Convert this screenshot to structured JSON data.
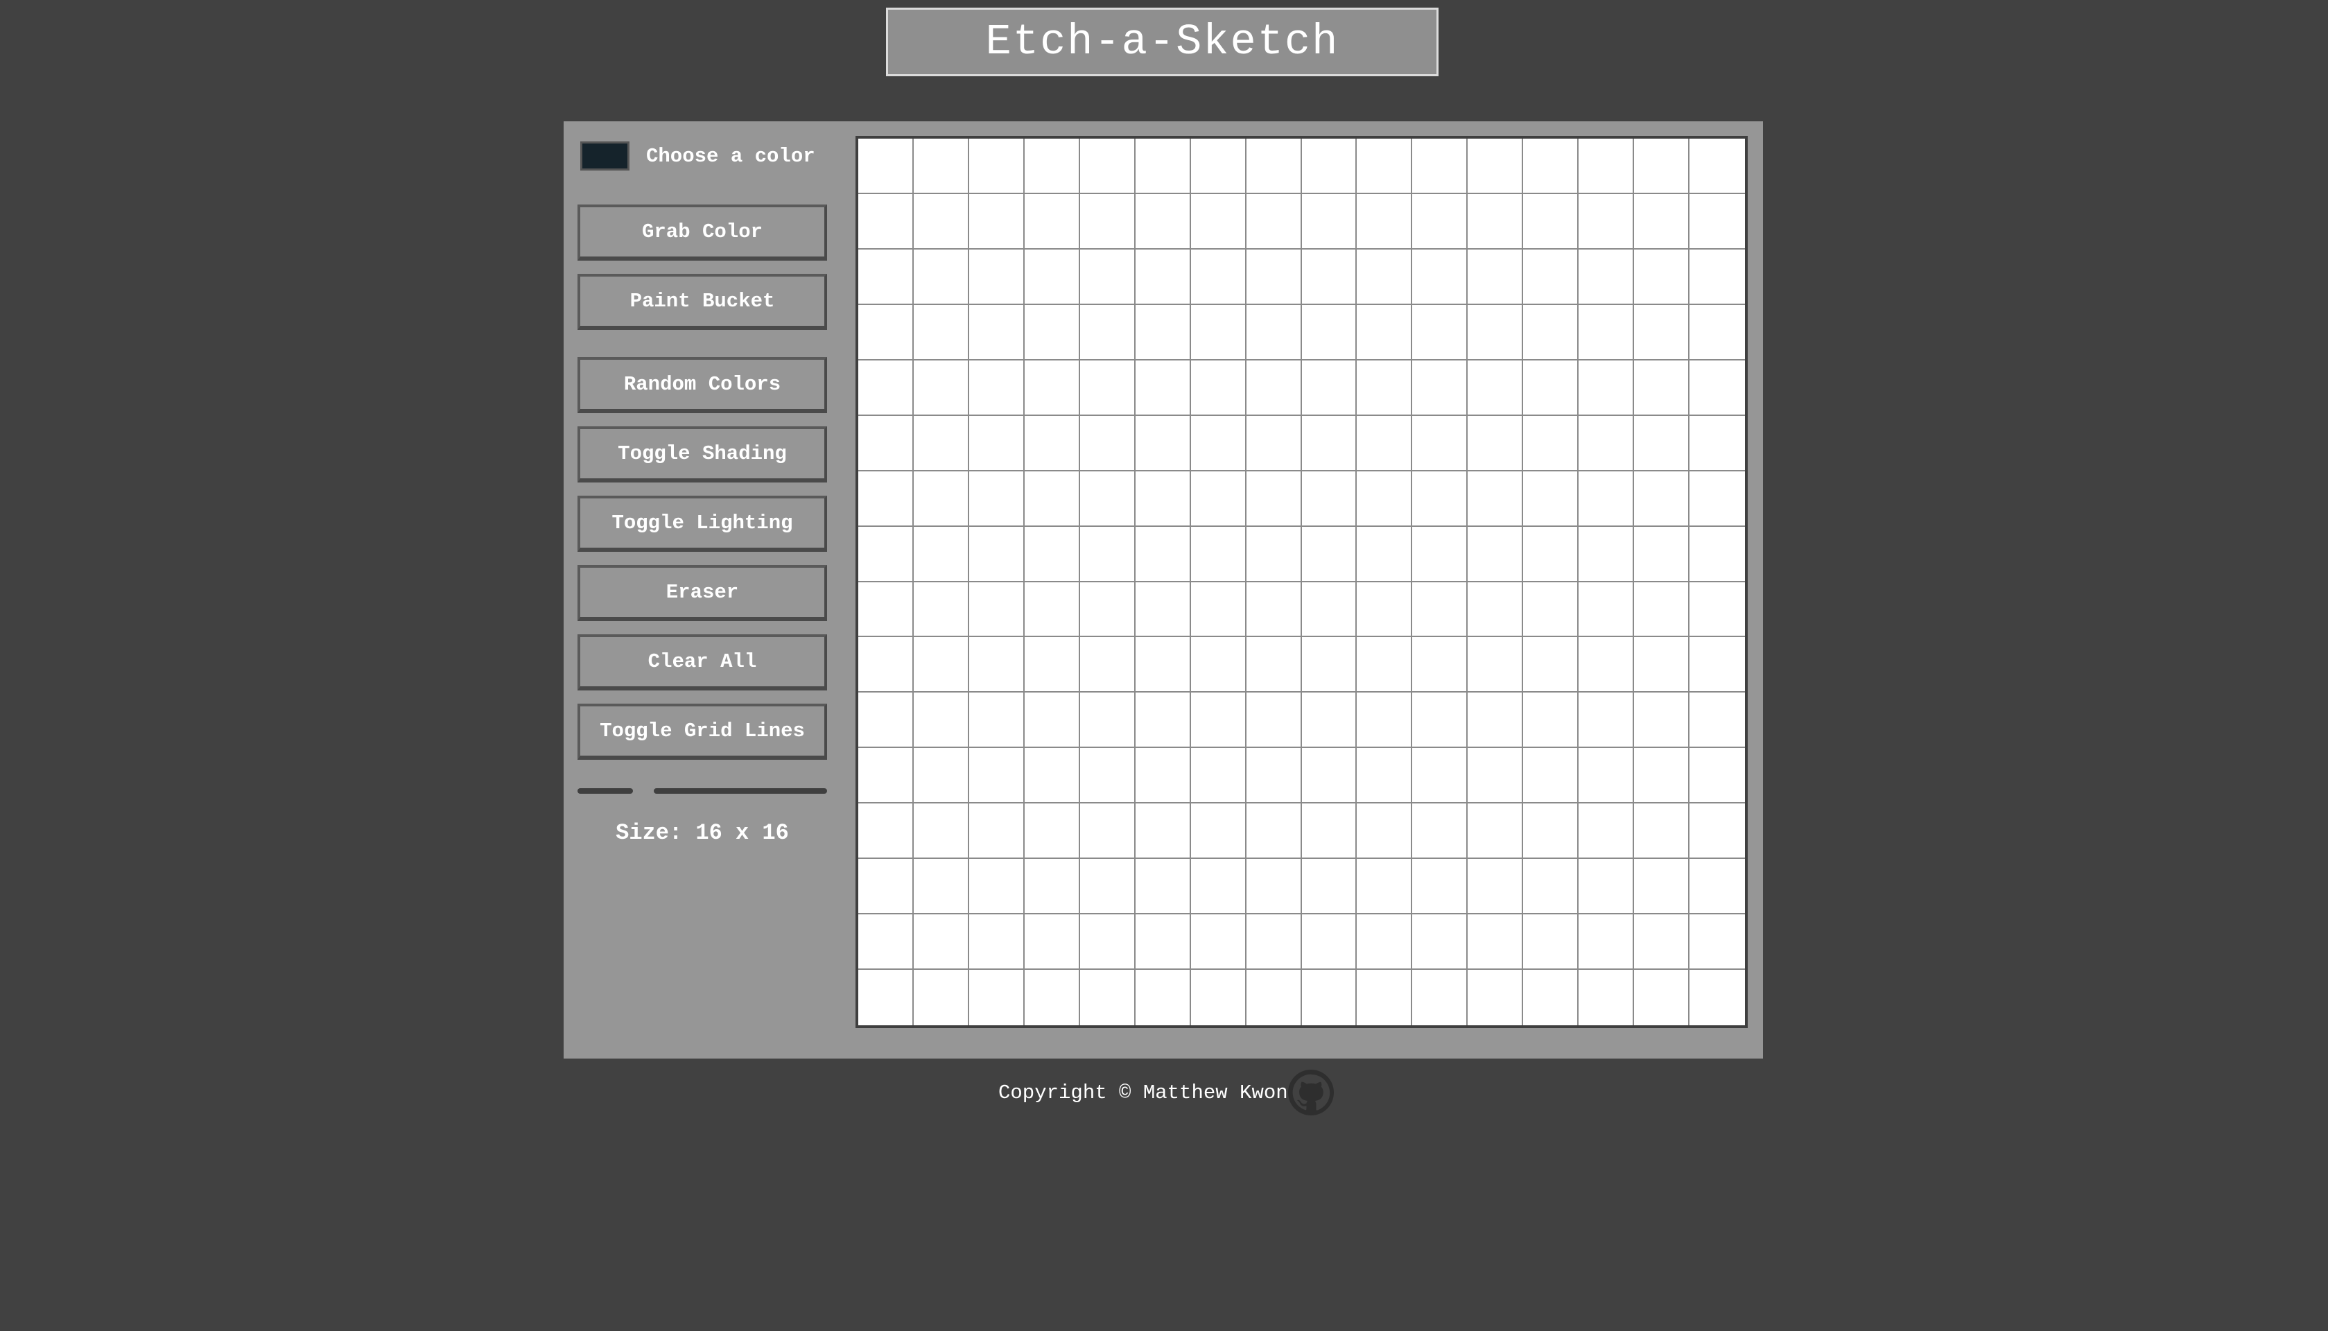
{
  "app": {
    "title": "Etch-a-Sketch"
  },
  "sidebar": {
    "color_picker": {
      "label": "Choose a color",
      "value": "#15232b"
    },
    "buttons": [
      {
        "label": "Grab Color"
      },
      {
        "label": "Paint Bucket"
      },
      {
        "label": "Random Colors"
      },
      {
        "label": "Toggle Shading"
      },
      {
        "label": "Toggle Lighting"
      },
      {
        "label": "Eraser"
      },
      {
        "label": "Clear All"
      },
      {
        "label": "Toggle Grid Lines"
      }
    ],
    "size_slider": {
      "value": 16
    },
    "size_label": "Size: 16 x 16"
  },
  "canvas": {
    "rows": 16,
    "cols": 16,
    "cell_color": "#ffffff",
    "grid_line_color": "#8a8a8a"
  },
  "footer": {
    "copyright": "Copyright © Matthew Kwon",
    "link_icon": "github-icon"
  },
  "colors": {
    "background": "#414141",
    "panel": "#969696",
    "title_box": "#8f8f8f"
  }
}
